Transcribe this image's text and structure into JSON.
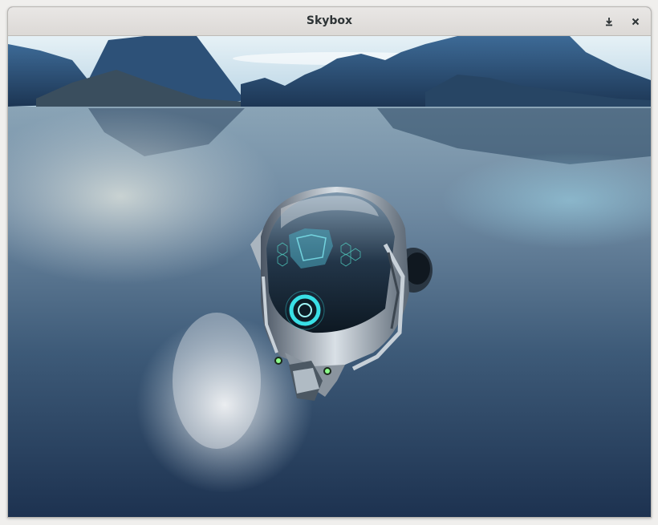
{
  "window": {
    "title": "Skybox"
  },
  "titlebar_buttons": [
    {
      "name": "minimize-button",
      "icon": "download-arrow-icon"
    },
    {
      "name": "close-button",
      "icon": "close-icon"
    }
  ],
  "scene": {
    "sky_color": "#cfe3ee",
    "mountain_color": "#2f4f72",
    "water_color": "#3e5b78",
    "ship_accent": "#39e0e6"
  }
}
